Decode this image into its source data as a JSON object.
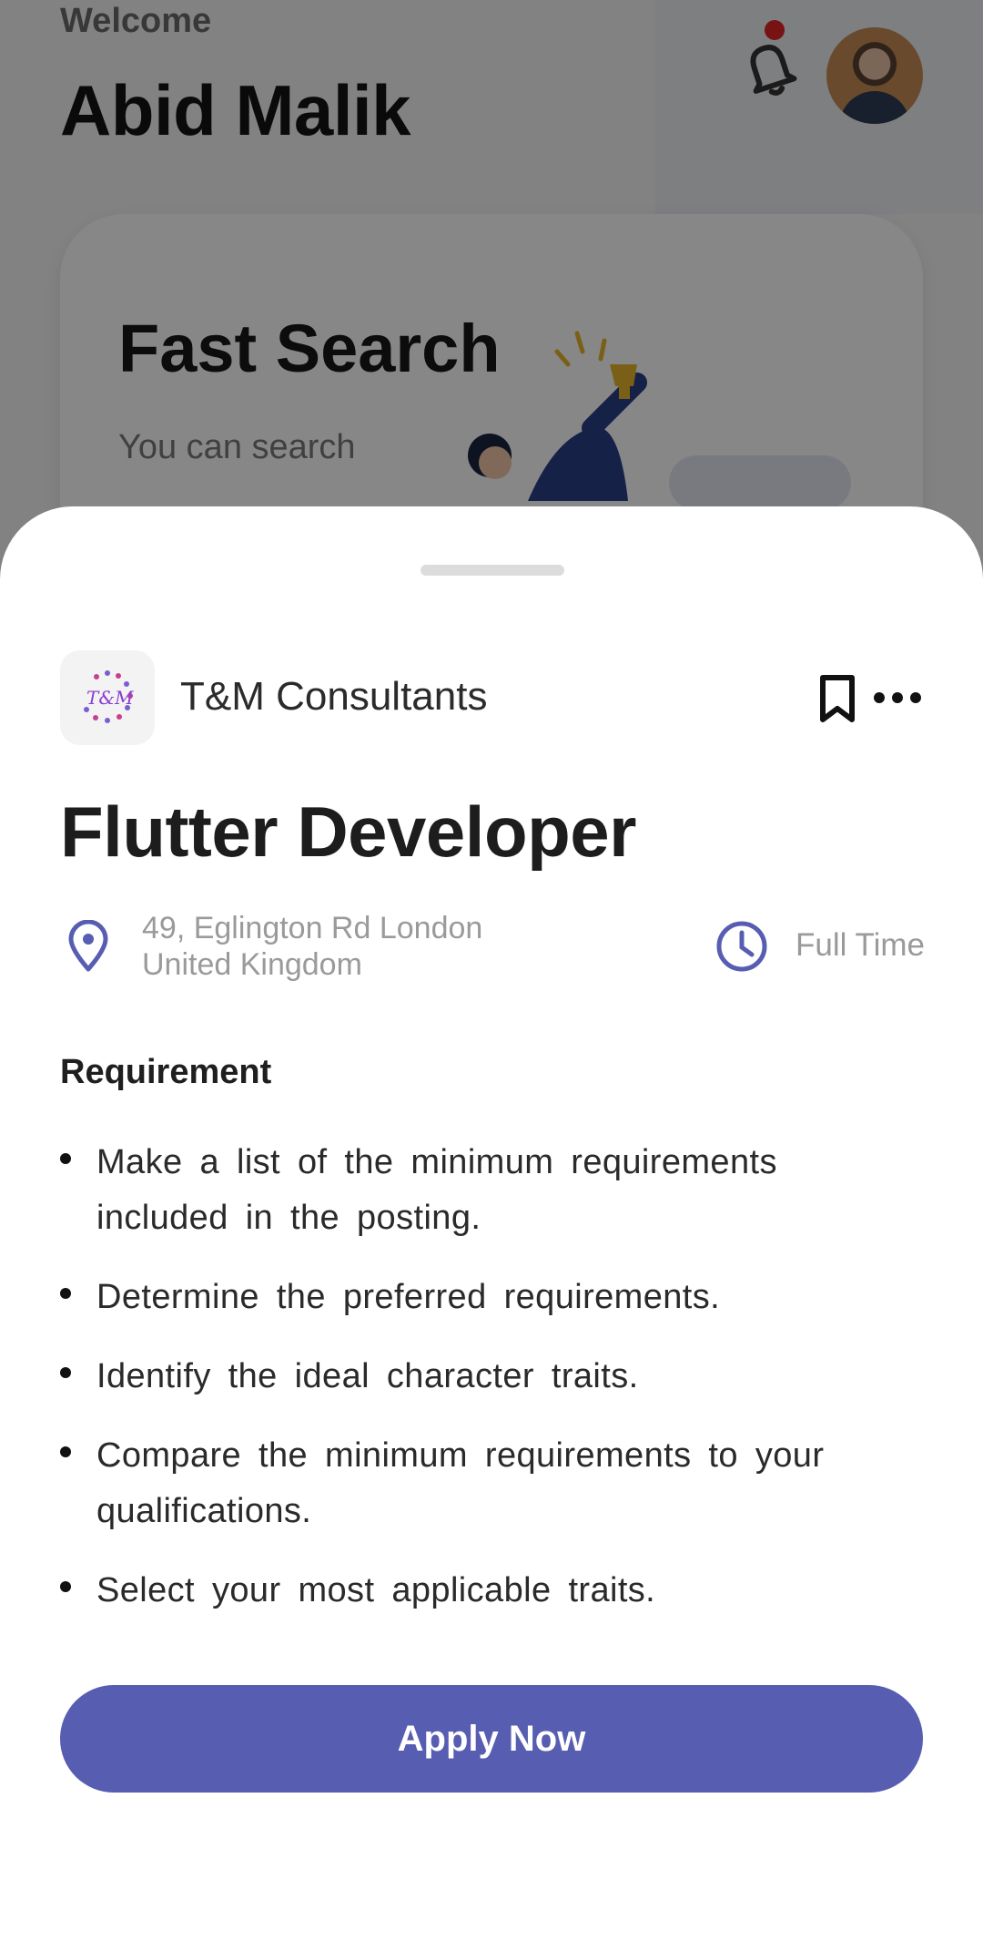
{
  "background": {
    "welcome_label": "Welcome",
    "user_name": "Abid Malik",
    "notification_dot_color": "#e02424",
    "search_card": {
      "title": "Fast Search",
      "subtitle": "You can search"
    }
  },
  "sheet": {
    "company": {
      "logo_text": "T&M",
      "name": "T&M Consultants"
    },
    "job_title": "Flutter Developer",
    "location": {
      "line1": "49, Eglington Rd London",
      "line2": "United Kingdom"
    },
    "job_type": "Full Time",
    "requirement_heading": "Requirement",
    "requirements": [
      "Make a list of the minimum requirements included in the posting.",
      "Determine the preferred requirements.",
      "Identify the ideal character traits.",
      "Compare the minimum requirements to your qualifications.",
      "Select your most applicable traits."
    ],
    "apply_label": "Apply Now",
    "accent_color": "#575db1"
  },
  "icons": {
    "bell": "bell-icon",
    "avatar": "avatar",
    "bookmark": "bookmark-icon",
    "more": "more-icon",
    "location": "location-pin-icon",
    "clock": "clock-icon"
  }
}
